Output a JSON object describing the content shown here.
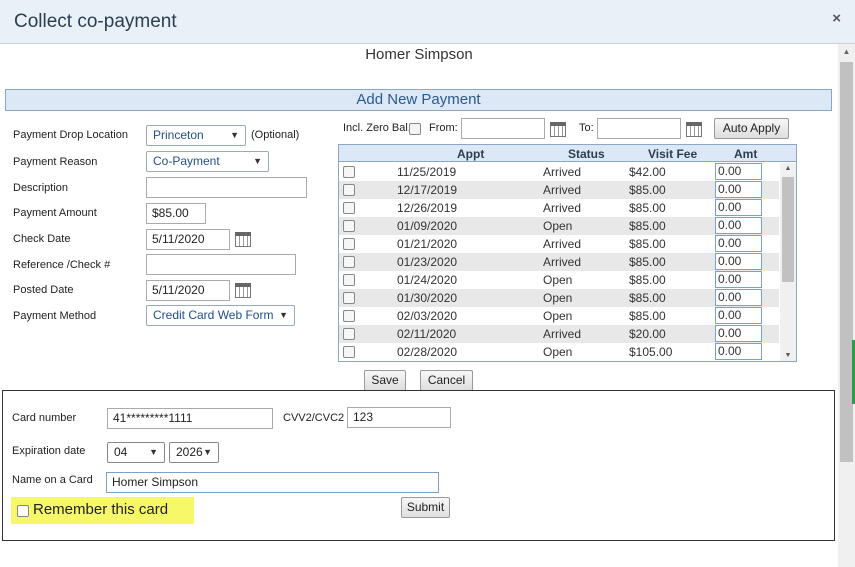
{
  "dialog": {
    "title": "Collect co-payment",
    "close_label": "×"
  },
  "patient_name": "Homer Simpson",
  "section_header": "Add New Payment",
  "form": {
    "drop_location": {
      "label": "Payment Drop Location",
      "value": "Princeton",
      "optional": "(Optional)"
    },
    "reason": {
      "label": "Payment Reason",
      "value": "Co-Payment"
    },
    "description": {
      "label": "Description",
      "value": ""
    },
    "amount": {
      "label": "Payment Amount",
      "value": "$85.00"
    },
    "check_date": {
      "label": "Check Date",
      "value": "5/11/2020"
    },
    "reference": {
      "label": "Reference /Check #",
      "value": ""
    },
    "posted_date": {
      "label": "Posted Date",
      "value": "5/11/2020"
    },
    "method": {
      "label": "Payment Method",
      "value": "Credit Card Web Form"
    }
  },
  "filters": {
    "incl_zero_label": "Incl. Zero Bal.",
    "from_label": "From:",
    "from_value": "",
    "to_label": "To:",
    "to_value": "",
    "auto_apply_label": "Auto Apply"
  },
  "grid": {
    "columns": [
      "Appt",
      "Status",
      "Visit Fee",
      "Amt"
    ],
    "rows": [
      {
        "appt": "11/25/2019",
        "status": "Arrived",
        "fee": "$42.00",
        "amt": "0.00"
      },
      {
        "appt": "12/17/2019",
        "status": "Arrived",
        "fee": "$85.00",
        "amt": "0.00"
      },
      {
        "appt": "12/26/2019",
        "status": "Arrived",
        "fee": "$85.00",
        "amt": "0.00"
      },
      {
        "appt": "01/09/2020",
        "status": "Open",
        "fee": "$85.00",
        "amt": "0.00"
      },
      {
        "appt": "01/21/2020",
        "status": "Arrived",
        "fee": "$85.00",
        "amt": "0.00"
      },
      {
        "appt": "01/23/2020",
        "status": "Arrived",
        "fee": "$85.00",
        "amt": "0.00"
      },
      {
        "appt": "01/24/2020",
        "status": "Open",
        "fee": "$85.00",
        "amt": "0.00"
      },
      {
        "appt": "01/30/2020",
        "status": "Open",
        "fee": "$85.00",
        "amt": "0.00"
      },
      {
        "appt": "02/03/2020",
        "status": "Open",
        "fee": "$85.00",
        "amt": "0.00"
      },
      {
        "appt": "02/11/2020",
        "status": "Arrived",
        "fee": "$20.00",
        "amt": "0.00"
      },
      {
        "appt": "02/28/2020",
        "status": "Open",
        "fee": "$105.00",
        "amt": "0.00"
      }
    ]
  },
  "actions": {
    "save_label": "Save",
    "cancel_label": "Cancel"
  },
  "card": {
    "number_label": "Card number",
    "number_value": "41*********1111",
    "cvv_label": "CVV2/CVC2",
    "cvv_value": "123",
    "exp_label": "Expiration date",
    "exp_month": "04",
    "exp_year": "2026",
    "name_label": "Name on a Card",
    "name_value": "Homer Simpson",
    "remember_label": "Remember this card",
    "submit_label": "Submit"
  }
}
